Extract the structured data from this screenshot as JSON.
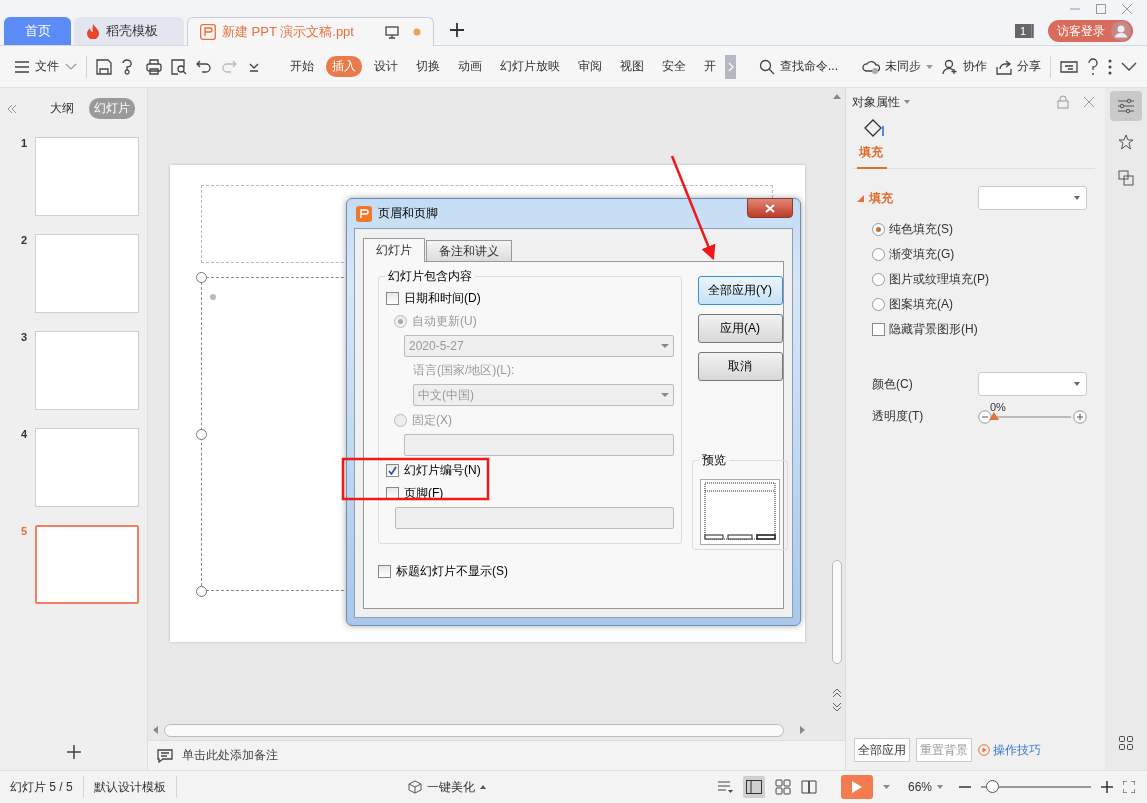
{
  "tabs": [
    {
      "label": "首页",
      "kind": "home",
      "selected": false
    },
    {
      "label": "稻壳模板",
      "kind": "docer",
      "selected": false
    },
    {
      "label": "新建 PPT 演示文稿.ppt",
      "kind": "document",
      "selected": true
    }
  ],
  "title_bar": {
    "badge": "1",
    "login": "访客登录"
  },
  "toolbar": {
    "file_menu": "文件",
    "ribbon_tabs": [
      {
        "label": "开始",
        "selected": false
      },
      {
        "label": "插入",
        "selected": true
      },
      {
        "label": "设计",
        "selected": false
      },
      {
        "label": "切换",
        "selected": false
      },
      {
        "label": "动画",
        "selected": false
      },
      {
        "label": "幻灯片放映",
        "selected": false
      },
      {
        "label": "审阅",
        "selected": false
      },
      {
        "label": "视图",
        "selected": false
      },
      {
        "label": "安全",
        "selected": false
      },
      {
        "label": "开",
        "selected": false
      }
    ],
    "search": "查找命令...",
    "sync": "未同步",
    "collab": "协作",
    "share": "分享"
  },
  "left_panel": {
    "tabs": [
      {
        "label": "大纲",
        "selected": false
      },
      {
        "label": "幻灯片",
        "selected": true
      }
    ],
    "slides": [
      {
        "number": "1",
        "selected": false
      },
      {
        "number": "2",
        "selected": false
      },
      {
        "number": "3",
        "selected": false
      },
      {
        "number": "4",
        "selected": false
      },
      {
        "number": "5",
        "selected": true
      }
    ]
  },
  "notes": {
    "placeholder": "单击此处添加备注"
  },
  "dialog": {
    "title": "页眉和页脚",
    "tabs": [
      {
        "label": "幻灯片",
        "selected": true
      },
      {
        "label": "备注和讲义",
        "selected": false
      }
    ],
    "group_title": "幻灯片包含内容",
    "date_time": {
      "label": "日期和时间(D)",
      "checked": false
    },
    "auto_update": {
      "label": "自动更新(U)",
      "selected": true
    },
    "date_value": "2020-5-27",
    "language_label": "语言(国家/地区)(L):",
    "language_value": "中文(中国)",
    "fixed": {
      "label": "固定(X)",
      "selected": false
    },
    "slide_number": {
      "label": "幻灯片编号(N)",
      "checked": true
    },
    "footer": {
      "label": "页脚(F)",
      "checked": false
    },
    "hide_on_title": {
      "label": "标题幻灯片不显示(S)",
      "checked": false
    },
    "buttons": [
      "全部应用(Y)",
      "应用(A)",
      "取消"
    ],
    "preview_label": "预览"
  },
  "properties_panel": {
    "title": "对象属性",
    "tab": "填充",
    "section": "填充",
    "fill_types": [
      {
        "label": "纯色填充(S)",
        "selected": true
      },
      {
        "label": "渐变填充(G)",
        "selected": false
      },
      {
        "label": "图片或纹理填充(P)",
        "selected": false
      },
      {
        "label": "图案填充(A)",
        "selected": false
      }
    ],
    "hide_background": {
      "label": "隐藏背景图形(H)",
      "checked": false
    },
    "color_label": "颜色(C)",
    "transparency_label": "透明度(T)",
    "transparency": {
      "reading": "0%",
      "level": 0
    },
    "buttons": [
      "全部应用",
      "重置背景"
    ],
    "tips_link": "操作技巧"
  },
  "status_bar": {
    "slide_info": "幻灯片 5 / 5",
    "template": "默认设计模板",
    "beautify": "一键美化",
    "zoom": "66%",
    "zoom_slider": {
      "level": 0.1
    }
  }
}
